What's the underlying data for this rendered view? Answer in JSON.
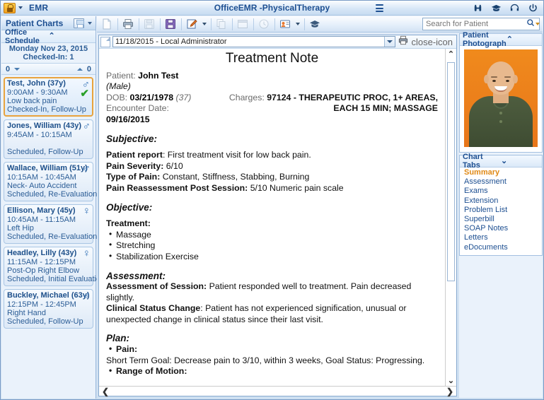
{
  "titlebar": {
    "app_name": "EMR",
    "center_title": "OfficeEMR -PhysicalTherapy",
    "lock_icon": "lock-icon",
    "icons": [
      "binoculars-icon",
      "graduation-cap-icon",
      "headset-icon",
      "power-icon"
    ]
  },
  "left_panel": {
    "title": "Patient Charts",
    "section_title": "Office Schedule",
    "schedule_date": "Monday Nov 23, 2015",
    "checked_in": "Checked-In: 1",
    "count_left": "0",
    "count_right": "0",
    "patients": [
      {
        "name": "Test, John (37y)",
        "time": "9:00AM - 9:30AM",
        "reason": "Low back pain",
        "status": "Checked-In, Follow-Up",
        "gender": "♂",
        "checked": "✔",
        "active": true
      },
      {
        "name": "Jones, William (43y)",
        "time": "9:45AM - 10:15AM",
        "reason": "",
        "status": "Scheduled, Follow-Up",
        "gender": "♂",
        "checked": "",
        "active": false
      },
      {
        "name": "Wallace, William (51y)",
        "time": "10:15AM - 10:45AM",
        "reason": "Neck- Auto Accident",
        "status": "Scheduled, Re-Evaluation",
        "gender": "♂",
        "checked": "",
        "active": false
      },
      {
        "name": "Ellison, Mary (45y)",
        "time": "10:45AM - 11:15AM",
        "reason": "Left Hip",
        "status": "Scheduled, Re-Evaluation",
        "gender": "♀",
        "checked": "",
        "active": false
      },
      {
        "name": "Headley, Lilly (43y)",
        "time": "11:15AM - 12:15PM",
        "reason": "Post-Op Right Elbow",
        "status": "Scheduled, Initial Evaluation",
        "gender": "♀",
        "checked": "",
        "active": false
      },
      {
        "name": "Buckley, Michael (63y)",
        "time": "12:15PM - 12:45PM",
        "reason": "Right Hand",
        "status": "Scheduled, Follow-Up",
        "gender": "♂",
        "checked": "",
        "active": false
      }
    ]
  },
  "toolbar": {
    "buttons": [
      "new-document-icon",
      "print-icon",
      "save-icon",
      "save-purple-icon",
      "edit-note-icon",
      "copy-icon",
      "calendar-icon",
      "clock-icon",
      "patient-card-icon",
      "graduation-cap-icon"
    ],
    "search_placeholder": "Search for Patient",
    "search_value": ""
  },
  "document": {
    "version_label": "11/18/2015 - Local Administrator",
    "print_icon": "print-icon",
    "close_icon": "close-icon",
    "title": "Treatment Note",
    "patient_label": "Patient:",
    "patient_name": "John Test",
    "gender": "(Male)",
    "dob_label": "DOB:",
    "dob_value": "03/21/1978",
    "dob_age": "(37)",
    "charges_label": "Charges:",
    "charges_line1": "97124 - THERAPEUTIC PROC, 1+ AREAS,",
    "charges_line2": "EACH 15 MIN; MASSAGE",
    "encounter_label": "Encounter Date:",
    "encounter_value": "09/16/2015",
    "subjective_heading": "Subjective:",
    "patient_report_label": "Patient report",
    "patient_report_value": ": First treatment visit for low back pain.",
    "pain_severity_label": "Pain Severity:",
    "pain_severity_value": "6/10",
    "type_of_pain_label": "Type of Pain:",
    "type_of_pain_value": "Constant, Stiffness, Stabbing, Burning",
    "pain_reassessment_label": "Pain Reassessment Post Session:",
    "pain_reassessment_value": "5/10 Numeric pain scale",
    "objective_heading": "Objective:",
    "treatment_label": "Treatment:",
    "treatments": [
      "Massage",
      "Stretching",
      "Stabilization Exercise"
    ],
    "assessment_heading": "Assessment:",
    "assessment_session_label": "Assessment of Session:",
    "assessment_session_value": "Patient responded well to treatment. Pain decreased slightly.",
    "clinical_status_label": "Clinical Status Change",
    "clinical_status_value": ": Patient has not experienced signification, unusual or unexpected change in clinical status since their last visit.",
    "plan_heading": "Plan:",
    "plan_pain_label": "Pain",
    "plan_pain_goal": "Short Term Goal: Decrease pain to 3/10, within 3 weeks, Goal Status: Progressing.",
    "plan_rom_label": "Range of Motion",
    "scroll_up": "⌃",
    "scroll_down": "⌄",
    "hscroll_left": "❮",
    "hscroll_right": "❯"
  },
  "right_panel": {
    "photo_title": "Patient Photograph",
    "tabs_title": "Chart Tabs",
    "tabs": [
      {
        "label": "Summary",
        "selected": true
      },
      {
        "label": "Assessment",
        "selected": false
      },
      {
        "label": "Exams",
        "selected": false
      },
      {
        "label": "Extension",
        "selected": false
      },
      {
        "label": "Problem List",
        "selected": false
      },
      {
        "label": "Superbill",
        "selected": false
      },
      {
        "label": "SOAP Notes",
        "selected": false
      },
      {
        "label": "Letters",
        "selected": false
      },
      {
        "label": "eDocuments",
        "selected": false
      }
    ]
  },
  "colors": {
    "accent_blue": "#1d4f91",
    "highlight_orange": "#e08a17",
    "active_border": "#e8a33d",
    "check_green": "#2aa02a"
  }
}
